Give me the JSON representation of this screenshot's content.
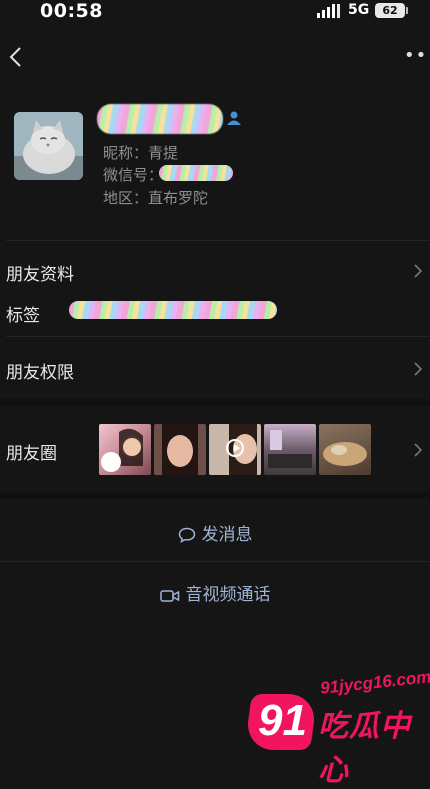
{
  "status_bar": {
    "time": "00:58",
    "network": "5G",
    "battery": "62"
  },
  "profile": {
    "nickname_label": "昵称：青提",
    "wechat_id_label": "微信号：",
    "region_label": "地区：直布罗陀"
  },
  "rows": {
    "friend_info": "朋友资料",
    "tags": "标签",
    "friend_permissions": "朋友权限",
    "moments": "朋友圈"
  },
  "actions": {
    "message": "发消息",
    "call": "音视频通话"
  },
  "watermark": {
    "number": "91",
    "url": "91jycg16.com",
    "brand": "吃瓜中心"
  },
  "icons": [
    "back-icon",
    "more-icon",
    "person-icon",
    "chevron-right-icon",
    "chat-bubble-icon",
    "video-camera-icon",
    "play-icon"
  ],
  "colors": {
    "background": "#151515",
    "action_text": "#9fb4d4",
    "watermark": "#f0155e"
  }
}
